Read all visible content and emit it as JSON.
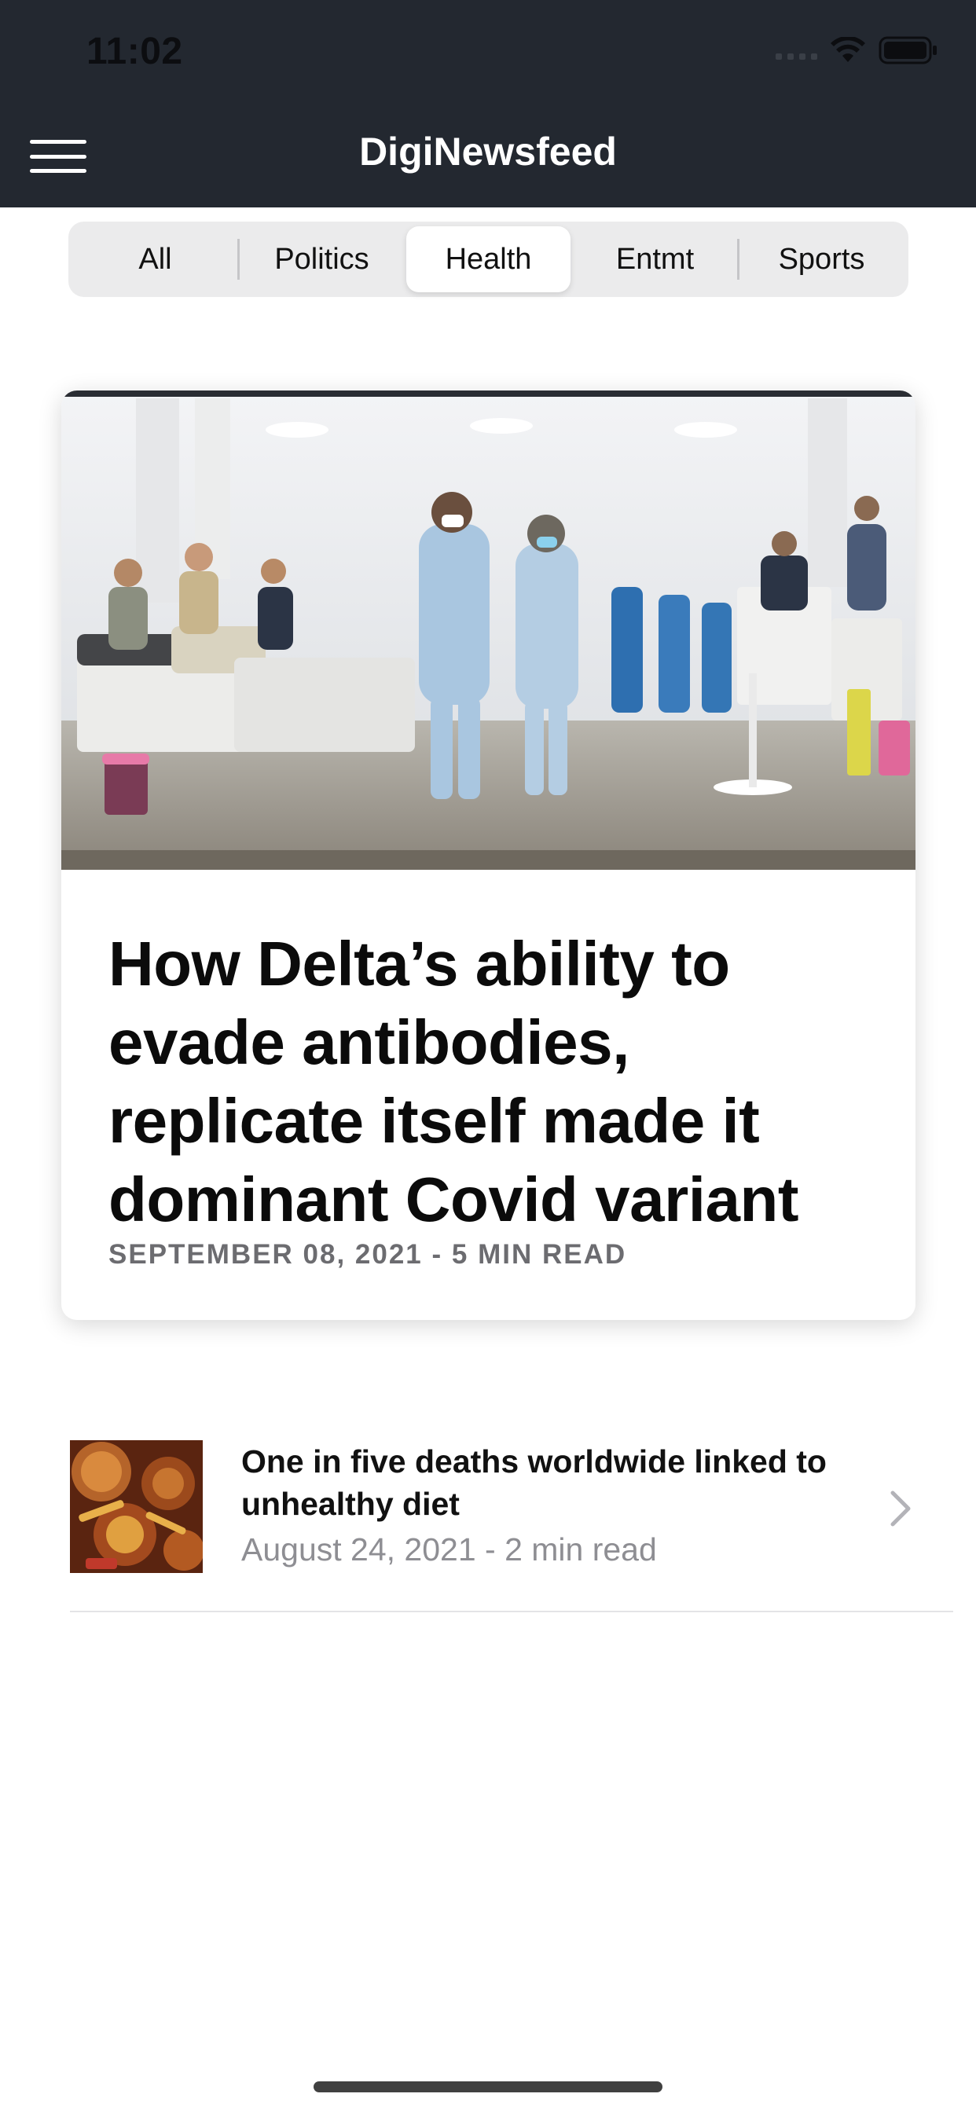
{
  "status_bar": {
    "time": "11:02",
    "icons": [
      "cellular-signal-icon",
      "wifi-icon",
      "battery-icon"
    ]
  },
  "header": {
    "title": "DigiNewsfeed",
    "menu_icon": "hamburger-menu-icon",
    "background_color": "#232830"
  },
  "categories": {
    "items": [
      "All",
      "Politics",
      "Health",
      "Entmt",
      "Sports"
    ],
    "selected": "Health"
  },
  "featured": {
    "title": "How Delta’s ability to evade antibodies, replicate itself made it dominant Covid variant",
    "meta": "SEPTEMBER 08, 2021 - 5 MIN READ"
  },
  "articles": [
    {
      "title": "One in five deaths worldwide linked to unhealthy diet",
      "meta": "August 24, 2021 - 2 min read",
      "icon": "chevron-right-icon"
    }
  ]
}
